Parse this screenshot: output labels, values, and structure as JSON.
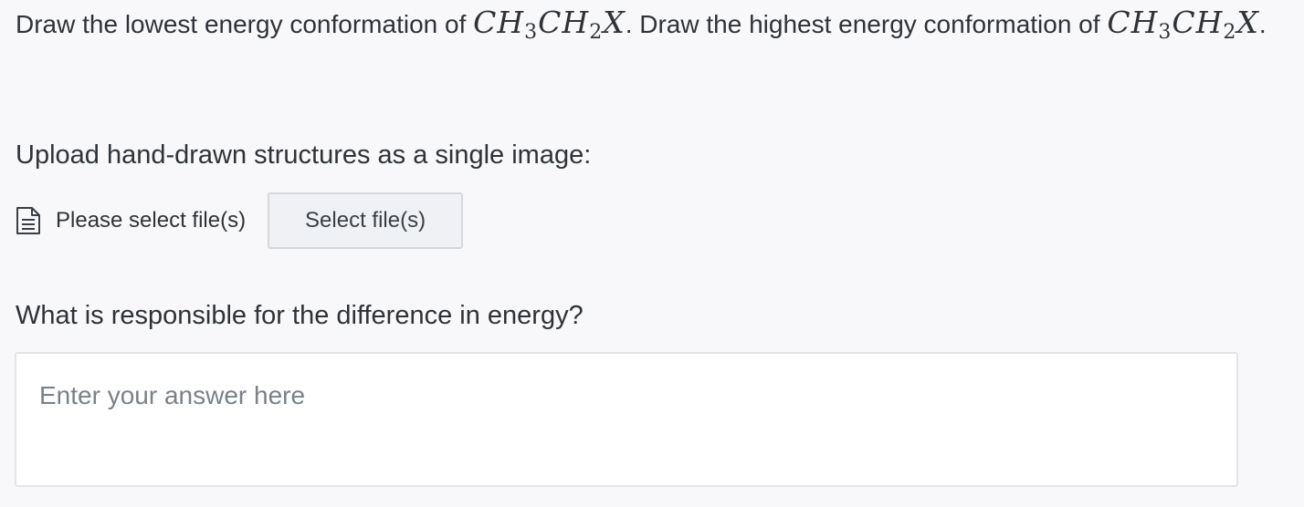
{
  "question": {
    "part1": "Draw the lowest energy conformation of ",
    "formula": {
      "c1": "C",
      "h1": "H",
      "sub1": "3",
      "c2": "C",
      "h2": "H",
      "sub2": "2",
      "x": "X"
    },
    "part2": ". Draw the highest energy conformation of ",
    "part3": "."
  },
  "upload": {
    "label": "Upload hand-drawn structures as a single image:",
    "file_status": "Please select file(s)",
    "button_label": "Select file(s)",
    "icon": "document-icon"
  },
  "energy_question": {
    "label": "What is responsible for the difference in energy?",
    "answer_value": "",
    "answer_placeholder": "Enter your answer here"
  }
}
